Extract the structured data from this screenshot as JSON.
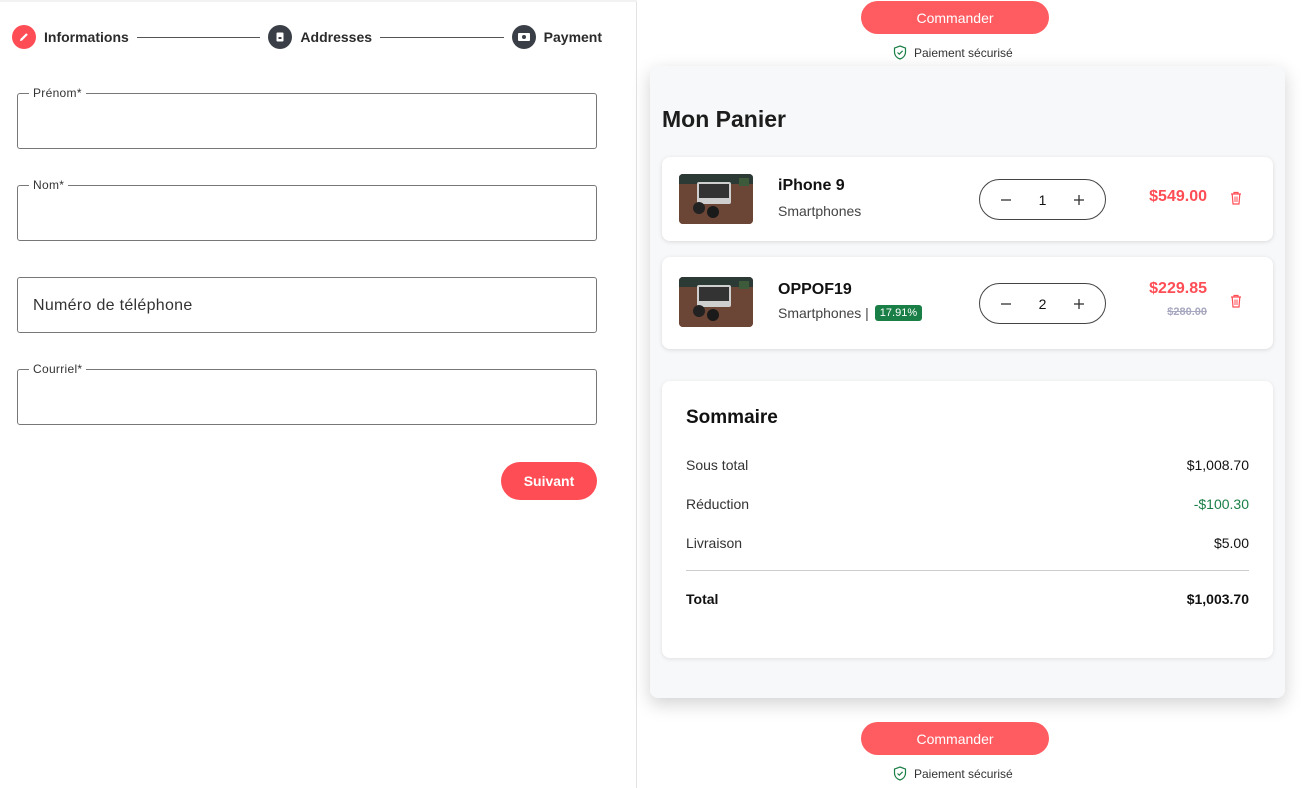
{
  "stepper": {
    "steps": [
      {
        "label": "Informations",
        "icon": "pencil-icon",
        "state": "active"
      },
      {
        "label": "Addresses",
        "icon": "address-icon",
        "state": "todo"
      },
      {
        "label": "Payment",
        "icon": "payment-icon",
        "state": "todo"
      }
    ]
  },
  "form": {
    "fields": [
      {
        "label": "Prénom*",
        "value": ""
      },
      {
        "label": "Nom*",
        "value": ""
      },
      {
        "placeholder": "Numéro de téléphone",
        "value": ""
      },
      {
        "label": "Courriel*",
        "value": ""
      }
    ],
    "next_label": "Suivant"
  },
  "order": {
    "button_label": "Commander",
    "secure_label": "Paiement sécurisé"
  },
  "cart": {
    "title": "Mon Panier",
    "items": [
      {
        "name": "iPhone 9",
        "category": "Smartphones",
        "quantity": "1",
        "price": "$549.00"
      },
      {
        "name": "OPPOF19",
        "category": "Smartphones |",
        "discount": "17.91%",
        "quantity": "2",
        "price": "$229.85",
        "old_price": "$280.00"
      }
    ]
  },
  "summary": {
    "title": "Sommaire",
    "rows": [
      {
        "label": "Sous total",
        "value": "$1,008.70"
      },
      {
        "label": "Réduction",
        "value": "-$100.30"
      },
      {
        "label": "Livraison",
        "value": "$5.00"
      }
    ],
    "total_label": "Total",
    "total_value": "$1,003.70"
  },
  "colors": {
    "accent": "#ff4d55",
    "discount_green": "#1a7f46"
  }
}
